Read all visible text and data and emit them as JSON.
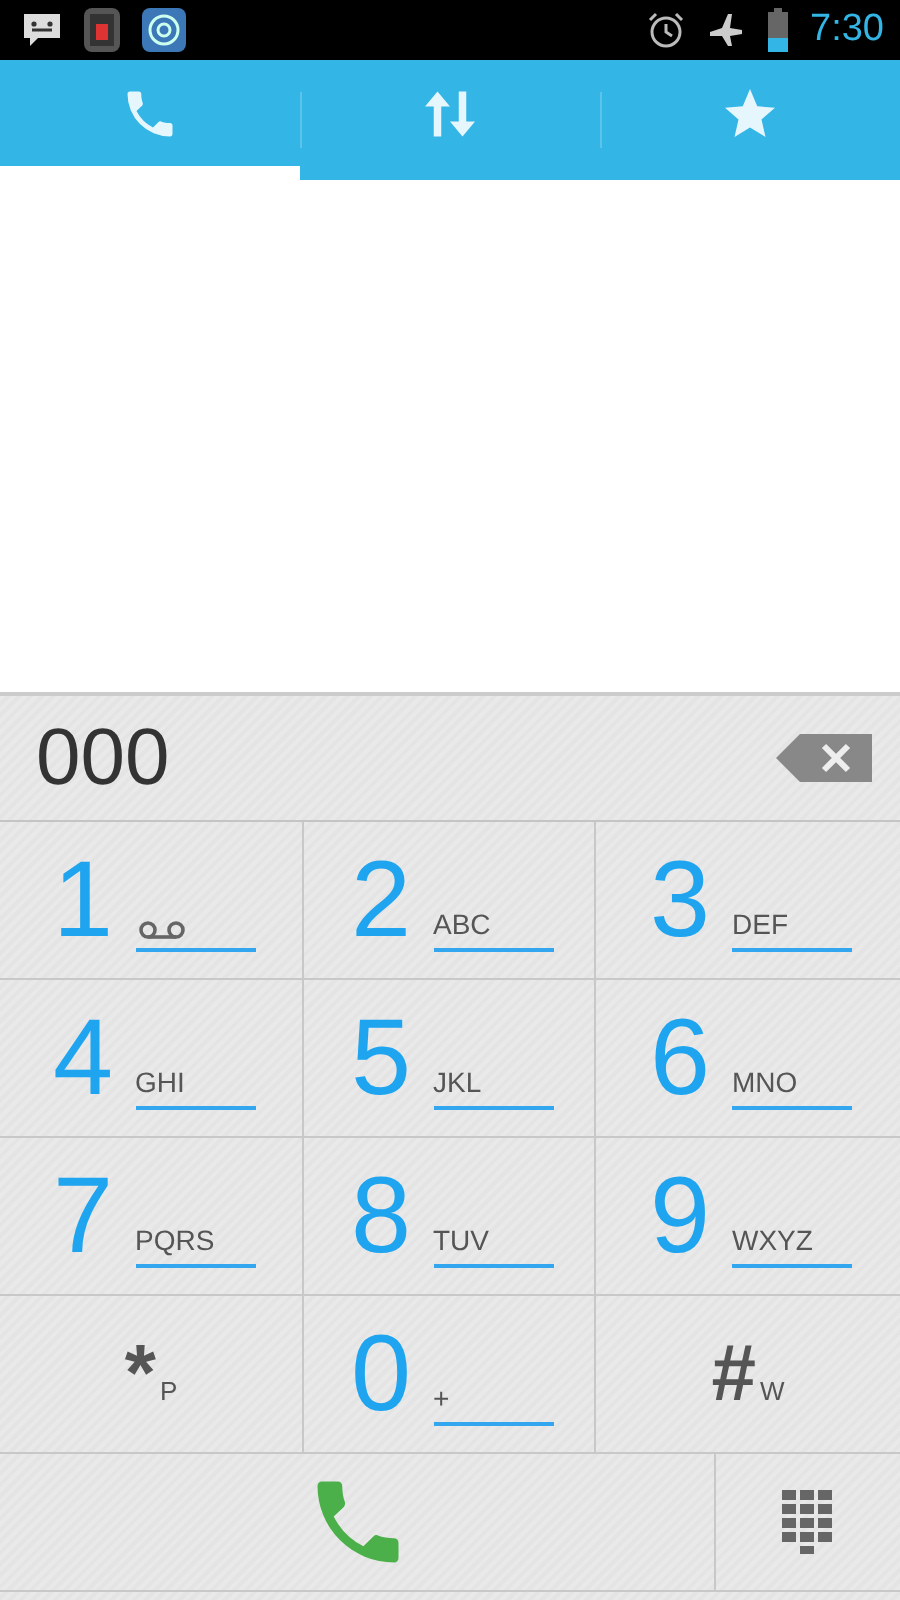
{
  "status_bar": {
    "time": "7:30"
  },
  "tabs": [
    {
      "kind": "phone",
      "selected": true
    },
    {
      "kind": "arrows",
      "selected": false
    },
    {
      "kind": "star",
      "selected": false
    }
  ],
  "dialer": {
    "number": "000",
    "keys": [
      {
        "kind": "voicemail",
        "digit": "1"
      },
      {
        "kind": "digit",
        "digit": "2",
        "letters": "ABC"
      },
      {
        "kind": "digit",
        "digit": "3",
        "letters": "DEF"
      },
      {
        "kind": "digit",
        "digit": "4",
        "letters": "GHI"
      },
      {
        "kind": "digit",
        "digit": "5",
        "letters": "JKL"
      },
      {
        "kind": "digit",
        "digit": "6",
        "letters": "MNO"
      },
      {
        "kind": "digit",
        "digit": "7",
        "letters": "PQRS"
      },
      {
        "kind": "digit",
        "digit": "8",
        "letters": "TUV"
      },
      {
        "kind": "digit",
        "digit": "9",
        "letters": "WXYZ"
      },
      {
        "kind": "symbol",
        "digit": "*",
        "letters": "P"
      },
      {
        "kind": "digit",
        "digit": "0",
        "letters": "+"
      },
      {
        "kind": "symbol",
        "digit": "#",
        "letters": "W"
      }
    ]
  }
}
